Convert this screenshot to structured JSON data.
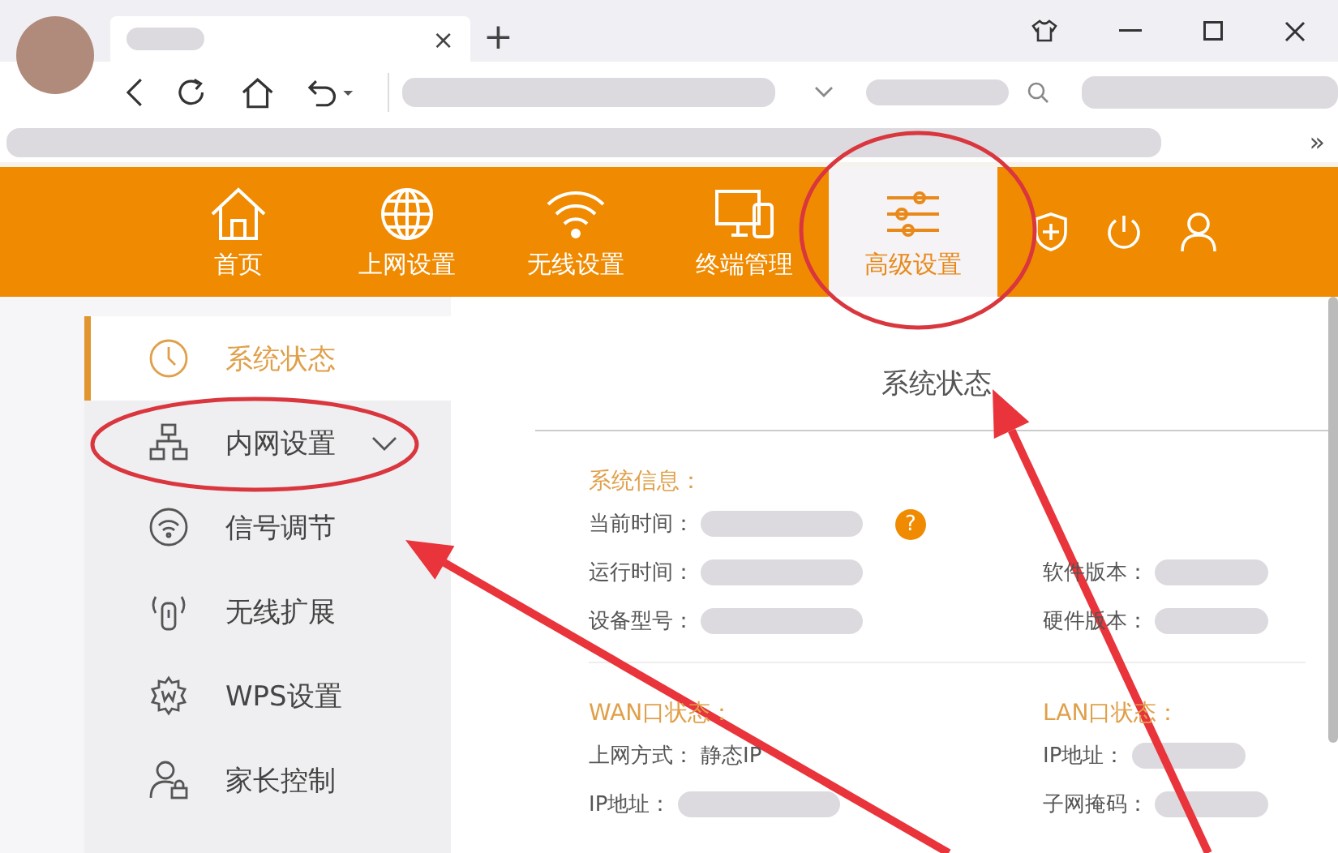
{
  "browser": {
    "tab_close": "×",
    "new_tab": "+",
    "bookmarks_more": "»"
  },
  "nav": {
    "items": [
      {
        "label": "首页",
        "selected": false
      },
      {
        "label": "上网设置",
        "selected": false
      },
      {
        "label": "无线设置",
        "selected": false
      },
      {
        "label": "终端管理",
        "selected": false
      },
      {
        "label": "高级设置",
        "selected": true
      }
    ]
  },
  "sidebar": {
    "items": [
      {
        "label": "系统状态",
        "selected": true,
        "expandable": false
      },
      {
        "label": "内网设置",
        "selected": false,
        "expandable": true
      },
      {
        "label": "信号调节",
        "selected": false,
        "expandable": false
      },
      {
        "label": "无线扩展",
        "selected": false,
        "expandable": false
      },
      {
        "label": "WPS设置",
        "selected": false,
        "expandable": false
      },
      {
        "label": "家长控制",
        "selected": false,
        "expandable": false
      }
    ]
  },
  "content": {
    "title": "系统状态",
    "sections": [
      {
        "headings": [
          "系统信息："
        ],
        "rows": [
          {
            "left": {
              "label": "当前时间：",
              "value_hidden": true,
              "help": "?"
            }
          },
          {
            "left": {
              "label": "运行时间：",
              "value_hidden": true
            },
            "right": {
              "label": "软件版本：",
              "value_hidden": true
            }
          },
          {
            "left": {
              "label": "设备型号：",
              "value_hidden": true
            },
            "right": {
              "label": "硬件版本：",
              "value_hidden": true
            }
          }
        ]
      },
      {
        "headings": [
          "WAN口状态：",
          "LAN口状态："
        ],
        "rows": [
          {
            "left": {
              "label": "上网方式：",
              "value": "静态IP"
            },
            "right": {
              "label": "IP地址：",
              "value_hidden": true
            }
          },
          {
            "left": {
              "label": "IP地址：",
              "value_hidden": true
            },
            "right": {
              "label": "子网掩码：",
              "value_hidden": true
            }
          }
        ]
      }
    ]
  }
}
